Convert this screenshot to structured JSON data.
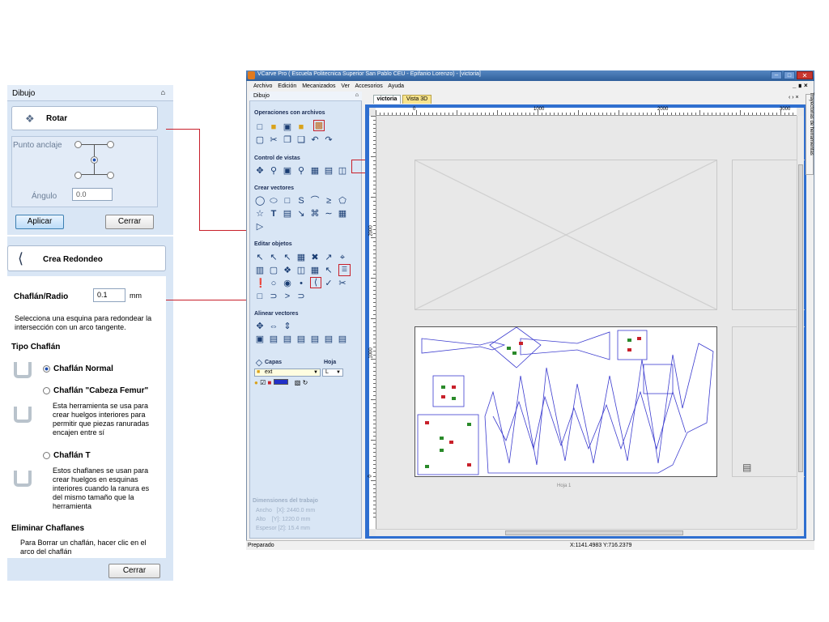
{
  "left_panel": {
    "title": "Dibujo",
    "pin": "⌥",
    "rotate": {
      "label": "Rotar",
      "anchor_label": "Punto anclaje",
      "angle_label": "Ángulo",
      "angle_value": "0.0",
      "apply": "Aplicar",
      "close": "Cerrar"
    },
    "fillet": {
      "label": "Crea Redondeo",
      "radius_label": "Chaflán/Radio",
      "radius_value": "0.1",
      "unit": "mm",
      "desc": "Selecciona una esquina para redondear la intersección con un arco tangente.",
      "type_header": "Tipo Chaflán",
      "opt_normal": "Chaflán Normal",
      "opt_femur": "Chaflán \"Cabeza Femur\"",
      "femur_desc": "Esta herramienta se usa para crear huelgos interiores para permitir que piezas ranuradas encajen entre sí",
      "opt_t": "Chaflán T",
      "t_desc": "Estos chaflanes se usan para crear  huelgos en esquinas interiores cuando la ranura es del mismo tamaño que la herramienta",
      "remove_header": "Eliminar Chaflanes",
      "remove_desc": "Para Borrar un chaflán, hacer clic en el arco del chaflán",
      "close": "Cerrar"
    }
  },
  "window": {
    "title": "VCarve Pro ( Escuela Politecnica Superior San Pablo CEU - Epifanio Lorenzo) - [victoria]",
    "menu": [
      "Archivo",
      "Edición",
      "Mecanizados",
      "Ver",
      "Accesorios",
      "Ayuda"
    ],
    "tabs": {
      "active": "victoria",
      "other": "Vista 3D"
    },
    "right_tab": "Trayectorias de herramientas",
    "status": "Preparado",
    "coords": "X:1141.4983 Y:716.2379",
    "sheet_label": "Hoja 1"
  },
  "drawing_panel": {
    "title": "Dibujo",
    "sections": {
      "files": "Operaciones con archivos",
      "view": "Control de vistas",
      "create": "Crear vectores",
      "edit": "Editar objetos",
      "align": "Alinear vectores"
    },
    "layers_label": "Capas",
    "sheet_label": "Hoja",
    "layer_value": "ext",
    "sheet_value": "L",
    "job_header": "Dimensiones del trabajo",
    "job_w": "Ancho   [X]: 2440.0 mm",
    "job_h": "Alto    [Y]: 1220.0 mm",
    "job_t": "Espesor [Z]: 15.4 mm"
  },
  "rulers": {
    "h_labels": [
      "0",
      "1000",
      "2000",
      "3000"
    ],
    "v_labels": [
      "2000",
      "1000",
      "0"
    ]
  },
  "colors": {
    "accent": "#3c6fbf",
    "highlight": "#c8202a",
    "panel": "#d9e6f5",
    "title_bar": "#3d6fa6"
  }
}
